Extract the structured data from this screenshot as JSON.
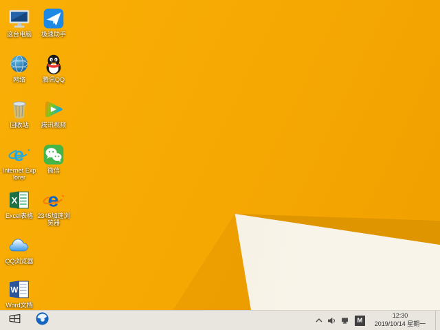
{
  "theme": {
    "wallpaper_orange": "#F5A702",
    "wallpaper_dark_band": "#DE9500",
    "wallpaper_light_wedge": "#F5EFDF",
    "taskbar_bg": "#E9E6E0"
  },
  "desktop": {
    "icons": [
      {
        "name": "this-pc",
        "label": "这台电脑"
      },
      {
        "name": "speed-assistant",
        "label": "极速助手"
      },
      {
        "name": "network",
        "label": "网络"
      },
      {
        "name": "tencent-qq",
        "label": "腾讯QQ"
      },
      {
        "name": "recycle-bin",
        "label": "回收站"
      },
      {
        "name": "tencent-video",
        "label": "腾讯视频"
      },
      {
        "name": "internet-explorer",
        "label": "Internet Explorer"
      },
      {
        "name": "wechat",
        "label": "微信"
      },
      {
        "name": "excel",
        "label": "Excel表格"
      },
      {
        "name": "browser-2345",
        "label": "2345加速浏览器"
      },
      {
        "name": "qq-browser",
        "label": "QQ浏览器"
      },
      {
        "name": "word",
        "label": "Word文档"
      }
    ]
  },
  "taskbar": {
    "pinned": [
      {
        "name": "browser"
      }
    ],
    "tray": {
      "icons": [
        "hidden-icons-expand",
        "volume",
        "network"
      ],
      "ime": "M",
      "time": "12:30",
      "date": "2019/10/14 星期一"
    }
  }
}
